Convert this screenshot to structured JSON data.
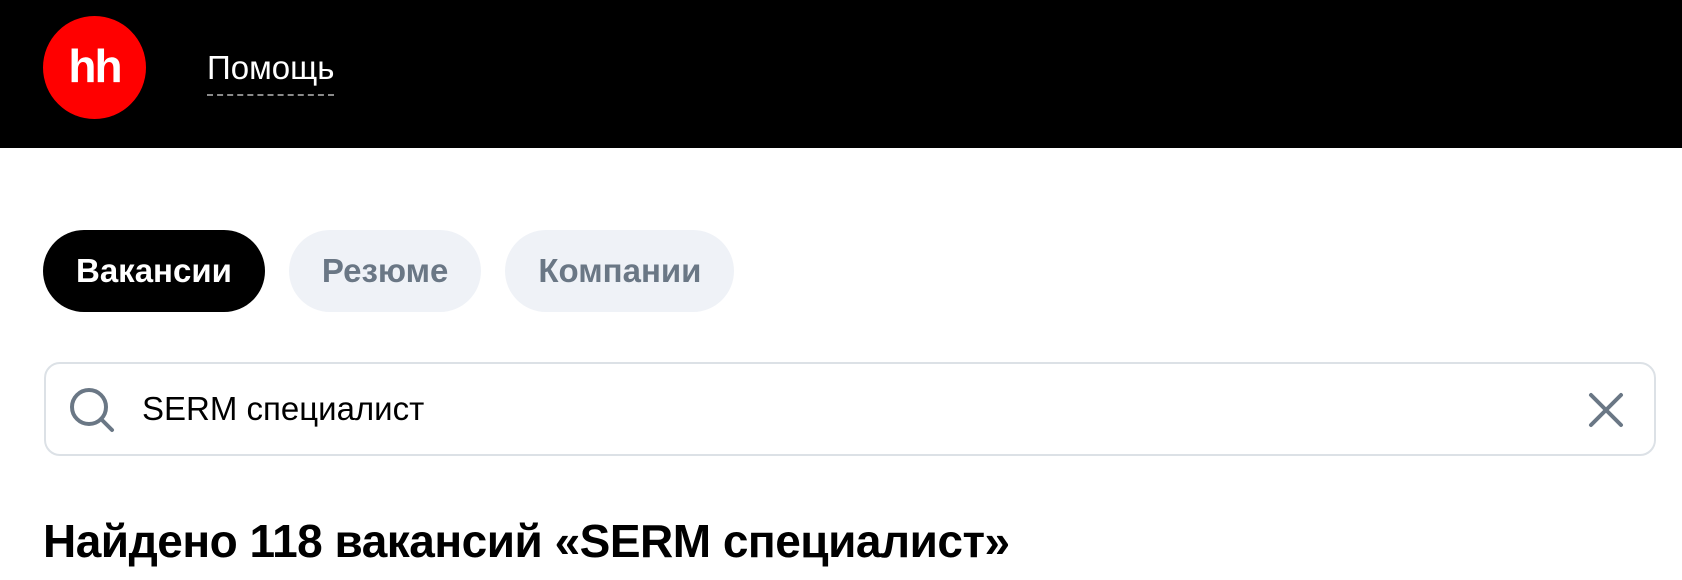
{
  "header": {
    "logo_text": "hh",
    "help_link": "Помощь"
  },
  "tabs": [
    {
      "label": "Вакансии",
      "active": true
    },
    {
      "label": "Резюме",
      "active": false
    },
    {
      "label": "Компании",
      "active": false
    }
  ],
  "search": {
    "value": "SERM специалист",
    "icon": "search-icon",
    "clear_icon": "close-icon"
  },
  "results": {
    "title": "Найдено 118 вакансий «SERM специалист»"
  },
  "colors": {
    "header_bg": "#000000",
    "logo_bg": "#ff0000",
    "tab_active_bg": "#000000",
    "tab_inactive_bg": "#eff2f7",
    "tab_inactive_text": "#6a7785",
    "search_border": "#dce1e6",
    "icon_color": "#6a7785"
  }
}
